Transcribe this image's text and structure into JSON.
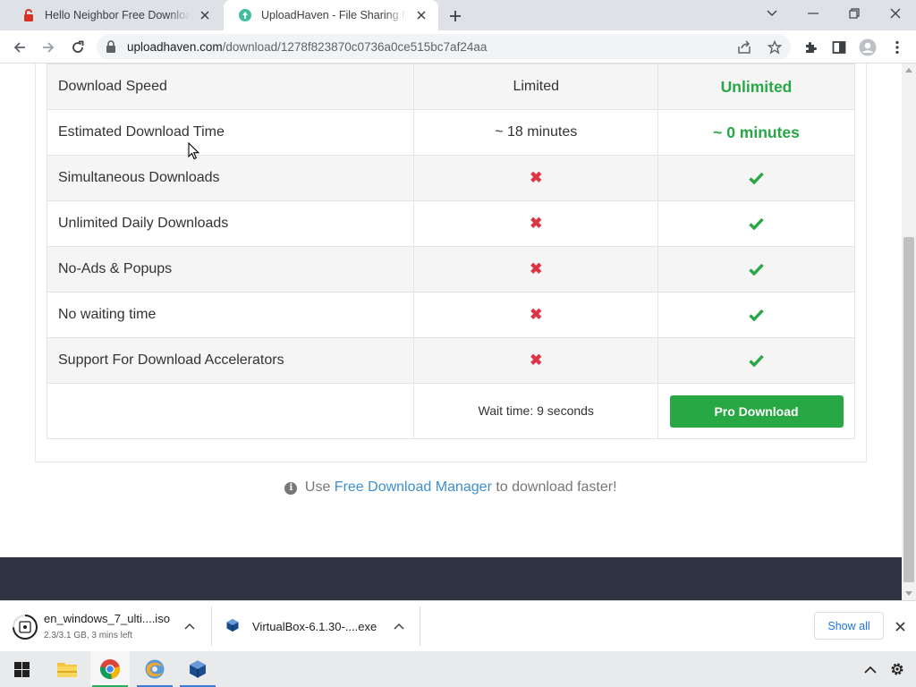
{
  "browser": {
    "tabs": [
      {
        "title": "Hello Neighbor Free Download (",
        "active": false
      },
      {
        "title": "UploadHaven - File Sharing Made",
        "active": true
      }
    ],
    "url_host": "uploadhaven.com",
    "url_path": "/download/1278f823870c0736a0ce515bc7af24aa"
  },
  "comparison": {
    "rows": [
      {
        "feature": "Download Speed",
        "free": "Limited",
        "pro": "Unlimited"
      },
      {
        "feature": "Estimated Download Time",
        "free": "~ 18 minutes",
        "pro": "~ 0 minutes"
      },
      {
        "feature": "Simultaneous Downloads",
        "free_icon": "cross-icon",
        "pro_icon": "check-icon"
      },
      {
        "feature": "Unlimited Daily Downloads",
        "free_icon": "cross-icon",
        "pro_icon": "check-icon"
      },
      {
        "feature": "No-Ads & Popups",
        "free_icon": "cross-icon",
        "pro_icon": "check-icon"
      },
      {
        "feature": "No waiting time",
        "free_icon": "cross-icon",
        "pro_icon": "check-icon"
      },
      {
        "feature": "Support For Download Accelerators",
        "free_icon": "cross-icon",
        "pro_icon": "check-icon"
      }
    ],
    "wait_text": "Wait time: 9 seconds",
    "pro_button": "Pro Download",
    "cross_glyph": "✖"
  },
  "fdm_tip": {
    "info_glyph": "i",
    "before": "Use",
    "link": "Free Download Manager",
    "after": "to download faster!"
  },
  "downloads": [
    {
      "name": "en_windows_7_ulti....iso",
      "status": "2.3/3.1 GB, 3 mins left",
      "progress": 0.74
    },
    {
      "name": "VirtualBox-6.1.30-....exe"
    }
  ],
  "shelf": {
    "show_all": "Show all"
  },
  "colors": {
    "pro_green": "#28a745",
    "cross_red": "#dc3545",
    "link_blue": "#3d8fd0",
    "footer": "#2f3342"
  }
}
